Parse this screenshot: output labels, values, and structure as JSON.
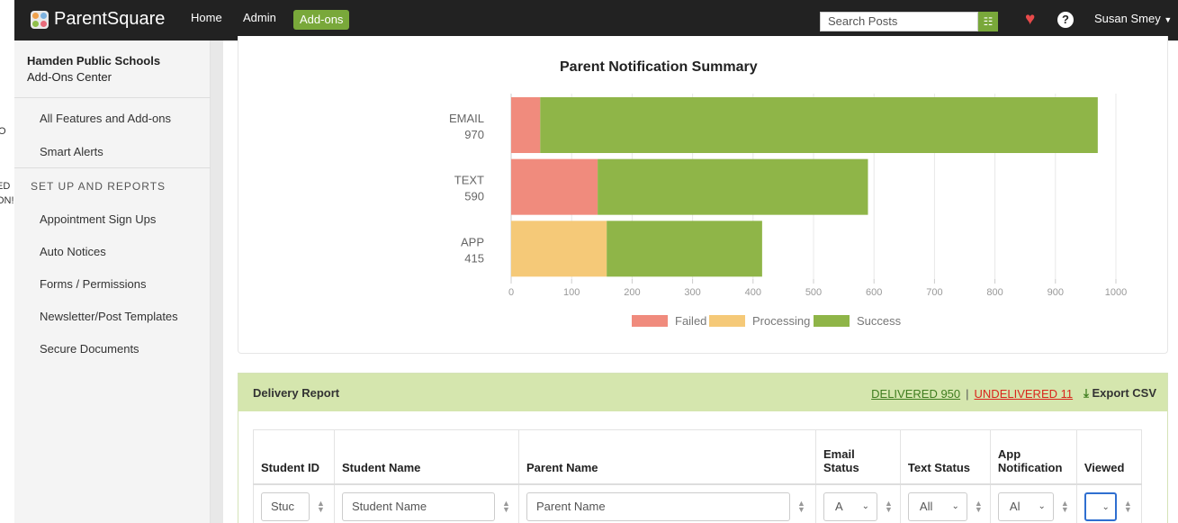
{
  "left_fragments": [
    "O",
    "ED",
    "ON!"
  ],
  "topbar": {
    "brand": "ParentSquare",
    "nav": [
      "Home",
      "Admin"
    ],
    "addons": "Add-ons",
    "search_placeholder": "Search Posts",
    "user": "Susan Smey",
    "icons": [
      "filter-icon",
      "heart-icon",
      "help-icon",
      "caret-down-icon"
    ]
  },
  "sidebar": {
    "org": "Hamden Public Schools",
    "sub": "Add-Ons Center",
    "items_top": [
      "All Features and Add-ons",
      "Smart Alerts"
    ],
    "section": "SET UP AND REPORTS",
    "items": [
      "Appointment Sign Ups",
      "Auto Notices",
      "Forms / Permissions",
      "Newsletter/Post Templates",
      "Secure Documents"
    ]
  },
  "chart_data": {
    "type": "bar",
    "orientation": "horizontal",
    "stacked": true,
    "title": "Parent Notification Summary",
    "categories": [
      "EMAIL",
      "TEXT",
      "APP"
    ],
    "totals": [
      "970",
      "590",
      "415"
    ],
    "series": [
      {
        "name": "Failed",
        "color": "#f08b7d",
        "values": [
          48,
          143,
          0
        ]
      },
      {
        "name": "Processing",
        "color": "#f5c978",
        "values": [
          0,
          0,
          158
        ]
      },
      {
        "name": "Success",
        "color": "#8fb548",
        "values": [
          922,
          447,
          257
        ]
      }
    ],
    "xlim": [
      0,
      1000
    ],
    "xticks": [
      "0",
      "100",
      "200",
      "300",
      "400",
      "500",
      "600",
      "700",
      "800",
      "900",
      "1000"
    ],
    "legend_position": "bottom",
    "grid": true
  },
  "delivery": {
    "title": "Delivery Report",
    "delivered": "DELIVERED 950",
    "separator": "|",
    "undelivered": "UNDELIVERED 11",
    "export": "Export CSV",
    "columns": [
      "Student ID",
      "Student Name",
      "Parent Name",
      "Email Status",
      "Text Status",
      "App Notification",
      "Viewed"
    ],
    "filters": {
      "student_id": "Stuc",
      "student_name": "Student Name",
      "parent_name": "Parent Name",
      "email": "A",
      "text": "All",
      "app": "Al",
      "viewed": ""
    }
  }
}
